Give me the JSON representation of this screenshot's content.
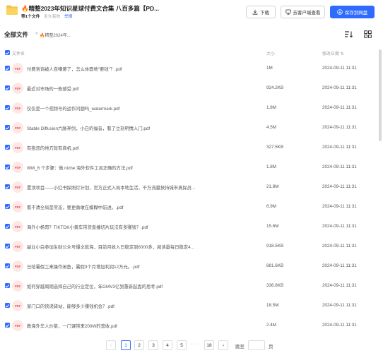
{
  "header": {
    "title": "🔥精整2023年知识星球付费文合集 八百多篇【PD...",
    "file_count": "等1个文件",
    "permanent": "永久有效",
    "report": "举报",
    "download_label": "下载",
    "client_label": "去客户端查看",
    "save_label": "保存到网盘"
  },
  "breadcrumb": {
    "all_files": "全部文件",
    "separator": ">",
    "current": "🔥精整2024年..."
  },
  "table": {
    "headers": {
      "name": "文件名",
      "size": "大小",
      "date": "修改日期 ⇅"
    },
    "rows": [
      {
        "icon": "PDF",
        "name": "付费咨询被人自嘲傻了，怎么体面地\"要钱\"？.pdf",
        "size": "1M",
        "date": "2024-09-11 11:31"
      },
      {
        "icon": "PDF",
        "name": "最近对市场的一些感受.pdf",
        "size": "924.2KB",
        "date": "2024-09-11 11:31"
      },
      {
        "icon": "PDF",
        "name": "仅仅是一个视频号的运作问题吗_watermark.pdf",
        "size": "1.8M",
        "date": "2024-09-11 11:31"
      },
      {
        "icon": "PDF",
        "name": "Stable Diffusion六脉神剑，小白的福音，看了立刻明情入门.pdf",
        "size": "4.5M",
        "date": "2024-09-11 11:31"
      },
      {
        "icon": "PDF",
        "name": "有抱怨的地方就有商机.pdf",
        "size": "327.5KB",
        "date": "2024-09-11 11:31"
      },
      {
        "icon": "PDF",
        "name": "WM_6 个步骤：做 niche 海外软件工具正确的方法.pdf",
        "size": "1.8M",
        "date": "2024-09-11 11:31"
      },
      {
        "icon": "PDF",
        "name": "置顶项目——小红书探照灯计划，官方正式入局本地生活，千万流量扶持城市真探员...",
        "size": "21.8M",
        "date": "2024-09-11 11:31"
      },
      {
        "icon": "PDF",
        "name": "看不清全局是常态，要更勇敢在模糊中前进。.pdf",
        "size": "6.9M",
        "date": "2024-09-11 11:31"
      },
      {
        "icon": "PDF",
        "name": "海外小杨哥？TIKTOK小黄车带货直播切片玩法有多赚钱？.pdf",
        "size": "15.6M",
        "date": "2024-09-11 11:31"
      },
      {
        "icon": "PDF",
        "name": "副业小白参加生财公众号爆文航海，目前月收入已稳定到6000多，阅读量每日稳定4...",
        "size": "918.5KB",
        "date": "2024-09-11 11:31"
      },
      {
        "icon": "PDF",
        "name": "日结暑假工来操作闲鱼，暑假3个月增加利润12万元。.pdf",
        "size": "881.6KB",
        "date": "2024-09-11 11:31"
      },
      {
        "icon": "PDF",
        "name": "如何穿越周期选择自己的行业定位，年GMV3亿到重新起盘的思考.pdf",
        "size": "336.8KB",
        "date": "2024-09-11 11:31"
      },
      {
        "icon": "PDF",
        "name": "家门口的快递驿站，能够多少赚钱机会？.pdf",
        "size": "18.5M",
        "date": "2024-09-11 11:31"
      },
      {
        "icon": "PDF",
        "name": "教海外华人炒菜，一门课带来200W的营收.pdf",
        "size": "2.4M",
        "date": "2024-09-11 11:31"
      }
    ]
  },
  "pagination": {
    "prev": "‹",
    "pages": [
      "1",
      "2",
      "3",
      "4",
      "5"
    ],
    "dots": "···",
    "last": "18",
    "next": "›",
    "goto_label": "跳至",
    "page_unit": "页"
  },
  "colors": {
    "accent": "#2f6bff",
    "pdf_badge": "#e8554e",
    "folder": "#f7c34a"
  }
}
